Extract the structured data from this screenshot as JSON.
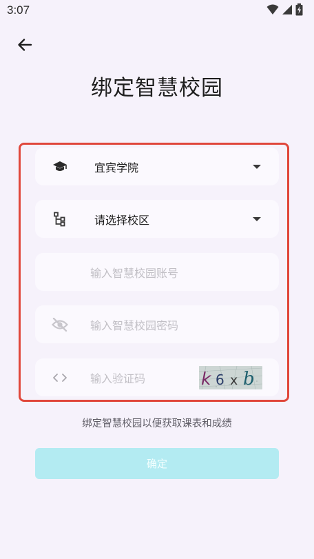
{
  "status_bar": {
    "time": "3:07",
    "icons": [
      "wifi-icon",
      "cellular-signal-icon",
      "battery-charging-icon"
    ]
  },
  "header": {
    "back_icon": "arrow-left-icon",
    "title": "绑定智慧校园"
  },
  "form": {
    "school": {
      "icon": "graduation-cap-icon",
      "value": "宜宾学院",
      "arrow_icon": "dropdown-triangle-icon"
    },
    "campus": {
      "icon": "sitemap-icon",
      "placeholder": "请选择校区",
      "arrow_icon": "dropdown-triangle-icon"
    },
    "account": {
      "placeholder": "输入智慧校园账号"
    },
    "password": {
      "icon": "eye-off-icon",
      "placeholder": "输入智慧校园密码"
    },
    "captcha": {
      "icon": "code-brackets-icon",
      "placeholder": "输入验证码",
      "image_text": "k6xb"
    }
  },
  "hint": "绑定智慧校园以便获取课表和成绩",
  "confirm_label": "确定",
  "colors": {
    "background": "#f6f2fb",
    "field_background": "#fbf9fe",
    "highlight_border": "#e0473b",
    "button_background": "#b3ebf2",
    "placeholder_text": "#c2c0c6"
  }
}
